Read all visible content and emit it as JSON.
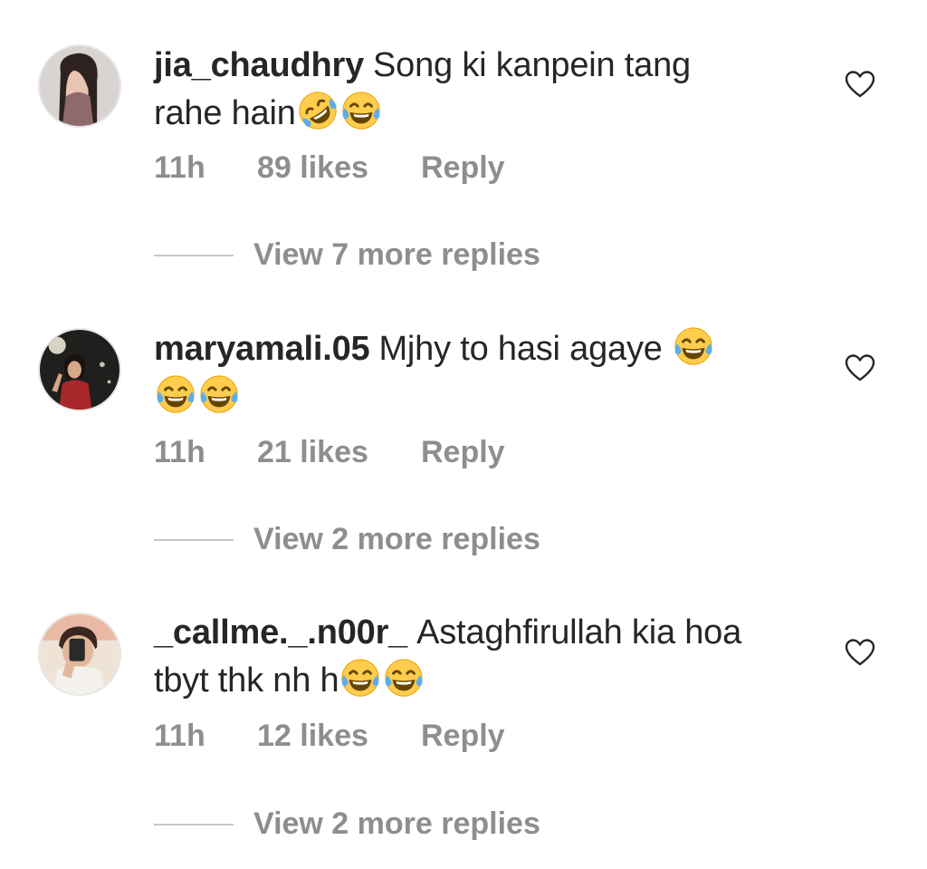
{
  "colors": {
    "text": "#262626",
    "secondary": "#8e8e8e",
    "divider": "#c7c7c7"
  },
  "comments": [
    {
      "username": "jia_chaudhry",
      "line1": "Song ki kanpein tang",
      "line2": "rahe hain",
      "line2_emojis": [
        "rolling-on-floor-laughing-emoji",
        "face-with-tears-of-joy-emoji"
      ],
      "time": "11h",
      "likes": "89 likes",
      "reply": "Reply",
      "view_replies": "View 7 more replies"
    },
    {
      "username": "maryamali.05",
      "line1": "Mjhy to hasi agaye",
      "line1_emojis": [
        "face-with-tears-of-joy-emoji"
      ],
      "line2_emojis": [
        "face-with-tears-of-joy-emoji",
        "face-with-tears-of-joy-emoji"
      ],
      "time": "11h",
      "likes": "21 likes",
      "reply": "Reply",
      "view_replies": "View 2 more replies"
    },
    {
      "username": "_callme._.n00r_",
      "line1": "Astaghfirullah kia hoa",
      "line2": "tbyt thk nh h",
      "line2_emojis": [
        "face-with-tears-of-joy-emoji",
        "face-with-tears-of-joy-emoji"
      ],
      "time": "11h",
      "likes": "12 likes",
      "reply": "Reply",
      "view_replies": "View 2 more replies"
    }
  ]
}
